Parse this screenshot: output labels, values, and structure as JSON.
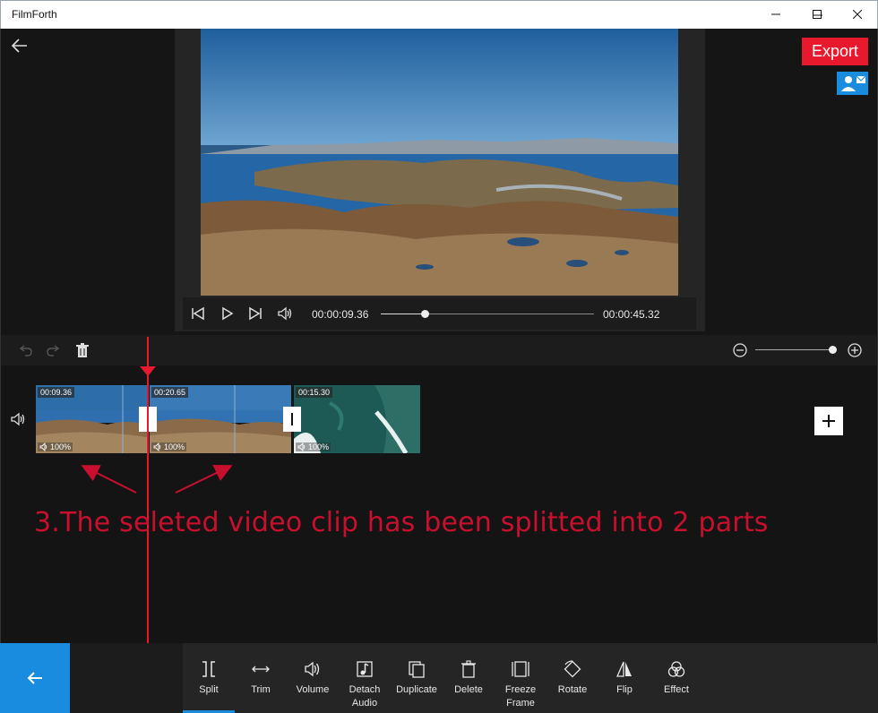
{
  "window": {
    "title": "FilmForth"
  },
  "player": {
    "current_time": "00:00:09.36",
    "total_time": "00:00:45.32",
    "progress": 0.207
  },
  "header": {
    "export_label": "Export"
  },
  "timeline": {
    "zoom_level": 0.95,
    "clips": [
      {
        "duration": "00:09.36",
        "volume": "100%",
        "selected": true
      },
      {
        "duration": "00:20.65",
        "volume": "100%",
        "selected": false
      },
      {
        "duration": "00:15.30",
        "volume": "100%",
        "selected": false
      }
    ]
  },
  "annotation": {
    "text": "3.The seleted video clip has been splitted into 2 parts"
  },
  "tools": [
    {
      "label": "Split",
      "icon": "split-icon",
      "active": true
    },
    {
      "label": "Trim",
      "icon": "trim-icon"
    },
    {
      "label": "Volume",
      "icon": "volume-icon"
    },
    {
      "label": "Detach\nAudio",
      "icon": "detach-audio-icon"
    },
    {
      "label": "Duplicate",
      "icon": "duplicate-icon"
    },
    {
      "label": "Delete",
      "icon": "delete-icon"
    },
    {
      "label": "Freeze\nFrame",
      "icon": "freeze-frame-icon"
    },
    {
      "label": "Rotate",
      "icon": "rotate-icon"
    },
    {
      "label": "Flip",
      "icon": "flip-icon"
    },
    {
      "label": "Effect",
      "icon": "effect-icon"
    }
  ],
  "colors": {
    "accent": "#1a8ce0",
    "export": "#e8192c",
    "playhead": "#e8192c",
    "selected_clip": "#9fd61a",
    "annotation": "#c8102e"
  }
}
